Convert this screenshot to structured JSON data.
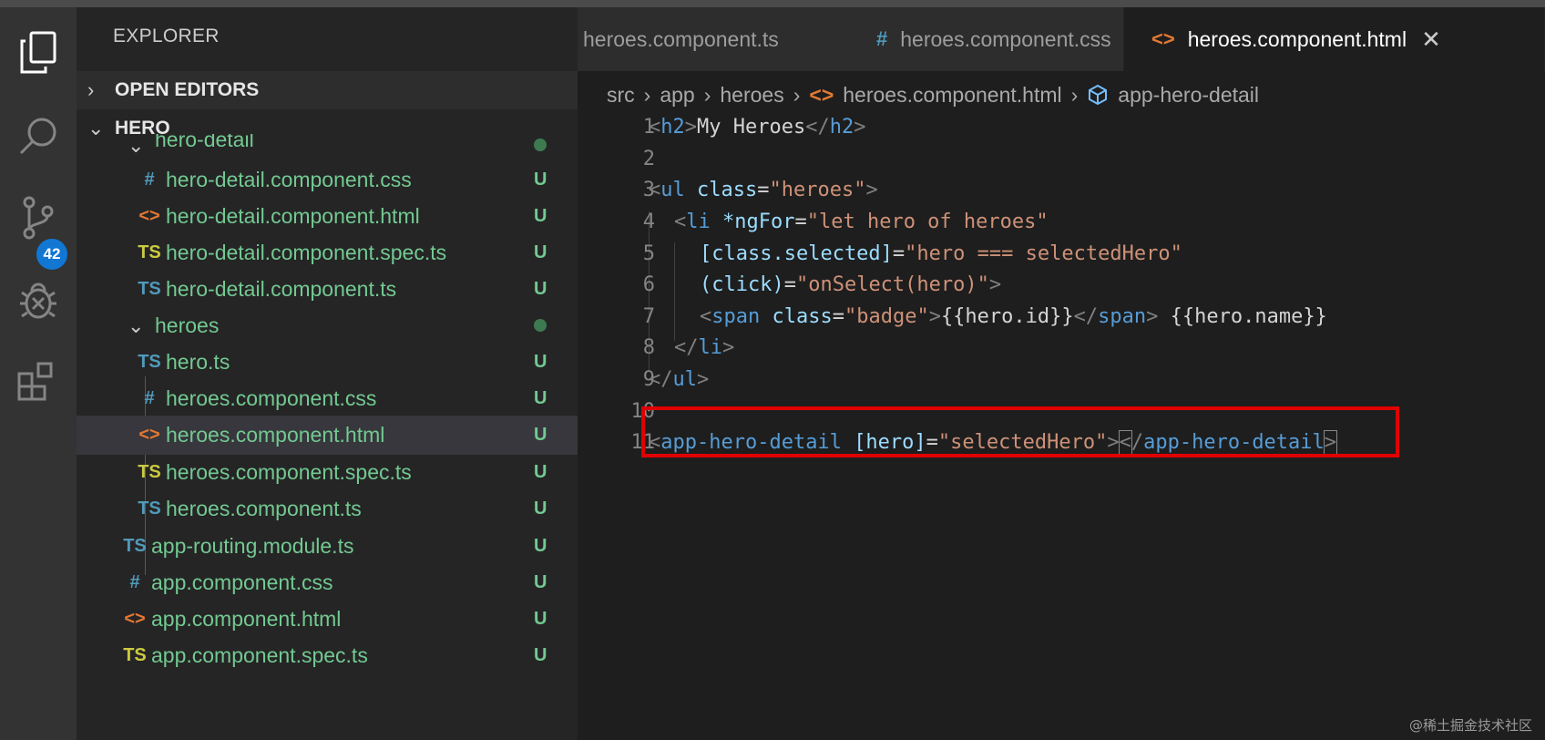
{
  "sidebar": {
    "title": "EXPLORER",
    "open_editors": "OPEN EDITORS",
    "workspace": "HERO",
    "source_control_badge": "42",
    "tree": [
      {
        "name": "hero-detail",
        "type": "folder",
        "status": ""
      },
      {
        "name": "hero-detail.component.css",
        "icon": "#",
        "status": "U"
      },
      {
        "name": "hero-detail.component.html",
        "icon": "<>",
        "status": "U"
      },
      {
        "name": "hero-detail.component.spec.ts",
        "icon": "TS",
        "status": "U"
      },
      {
        "name": "hero-detail.component.ts",
        "icon": "TS",
        "status": "U"
      },
      {
        "name": "heroes",
        "type": "folder",
        "status": ""
      },
      {
        "name": "hero.ts",
        "icon": "TS",
        "status": "U"
      },
      {
        "name": "heroes.component.css",
        "icon": "#",
        "status": "U"
      },
      {
        "name": "heroes.component.html",
        "icon": "<>",
        "status": "U"
      },
      {
        "name": "heroes.component.spec.ts",
        "icon": "TS",
        "status": "U"
      },
      {
        "name": "heroes.component.ts",
        "icon": "TS",
        "status": "U"
      },
      {
        "name": "app-routing.module.ts",
        "icon": "TS",
        "status": "U"
      },
      {
        "name": "app.component.css",
        "icon": "#",
        "status": "U"
      },
      {
        "name": "app.component.html",
        "icon": "<>",
        "status": "U"
      },
      {
        "name": "app.component.spec.ts",
        "icon": "TS",
        "status": "U"
      }
    ]
  },
  "tabs": [
    {
      "label": "heroes.component.ts",
      "icon": ""
    },
    {
      "label": "heroes.component.css",
      "icon": "#"
    },
    {
      "label": "heroes.component.html",
      "icon": "<>",
      "close": "✕"
    }
  ],
  "breadcrumb": [
    "src",
    "app",
    "heroes",
    "heroes.component.html",
    "app-hero-detail"
  ],
  "line_numbers": [
    "1",
    "2",
    "3",
    "4",
    "5",
    "6",
    "7",
    "8",
    "9",
    "10",
    "11"
  ],
  "code": {
    "l1": {
      "t1": "<",
      "tag": "h2",
      "t2": ">",
      "text": "My Heroes",
      "t3": "</",
      "tag2": "h2",
      "t4": ">"
    },
    "l3": {
      "t1": "<",
      "tag": "ul",
      "attr": "class",
      "eq": "=",
      "val": "\"heroes\"",
      "t2": ">"
    },
    "l4": {
      "t1": "<",
      "tag": "li",
      "attr": "*ngFor",
      "eq": "=",
      "val": "\"let hero of heroes\""
    },
    "l5": {
      "attr": "[class.selected]",
      "eq": "=",
      "val": "\"hero === selectedHero\""
    },
    "l6": {
      "attr": "(click)",
      "eq": "=",
      "val": "\"onSelect(hero)\"",
      "t2": ">"
    },
    "l7": {
      "t1": "<",
      "tag": "span",
      "attr": "class",
      "eq": "=",
      "val": "\"badge\"",
      "t2": ">",
      "text": "{{hero.id}}",
      "t3": "</",
      "tag2": "span",
      "t4": ">",
      "text2": " {{hero.name}}"
    },
    "l8": {
      "t1": "</",
      "tag": "li",
      "t2": ">"
    },
    "l9": {
      "t1": "</",
      "tag": "ul",
      "t2": ">"
    },
    "l11": {
      "t1": "<",
      "tag": "app-hero-detail",
      "attr": "[hero]",
      "eq": "=",
      "val": "\"selectedHero\"",
      "t2": ">",
      "t3": "<",
      "t3b": "/",
      "tag2": "app-hero-detail",
      "t4": ">"
    }
  },
  "watermark": "@稀土掘金技术社区",
  "colors": {
    "highlight_box": "#e00000",
    "tree_text": "#73c991",
    "badge": "#1177d3"
  }
}
